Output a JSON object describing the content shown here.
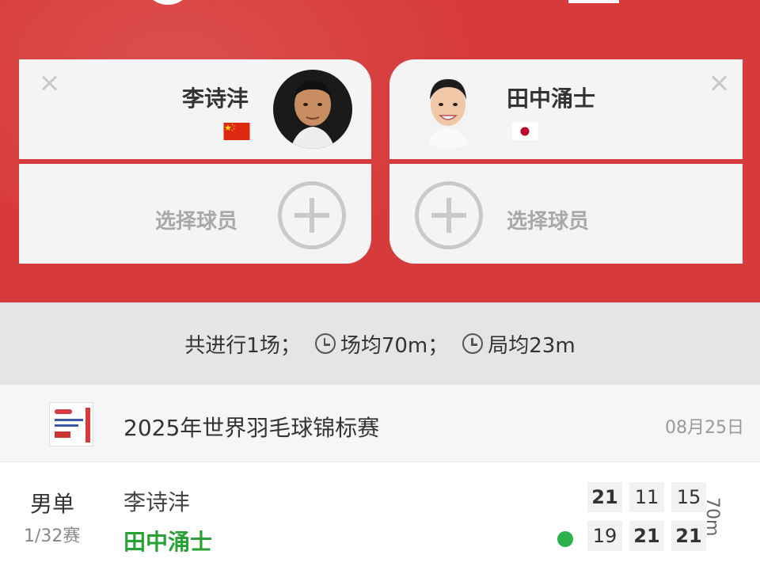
{
  "players": {
    "left": {
      "name": "李诗沣",
      "country": "China",
      "flag_colors": {
        "field": "#de2910",
        "star": "#ffde00"
      }
    },
    "right": {
      "name": "田中涌士",
      "country": "Japan",
      "flag_colors": {
        "field": "#ffffff",
        "disc": "#bc002d"
      }
    },
    "add_player_label": "选择球员"
  },
  "stats": {
    "matches": "共进行1场；",
    "avg_match": "场均70m；",
    "avg_game": "局均23m"
  },
  "tournament": {
    "name": "2025年世界羽毛球锦标赛",
    "date": "08月25日"
  },
  "match": {
    "event": "男单",
    "round": "1/32赛",
    "player1": "李诗沣",
    "player2": "田中涌士",
    "scores_p1": [
      "21",
      "11",
      "15"
    ],
    "scores_p2": [
      "19",
      "21",
      "21"
    ],
    "duration": "70m",
    "winner": "player2"
  },
  "colors": {
    "header_red": "#d73a3a",
    "winner_green": "#2aa137"
  }
}
